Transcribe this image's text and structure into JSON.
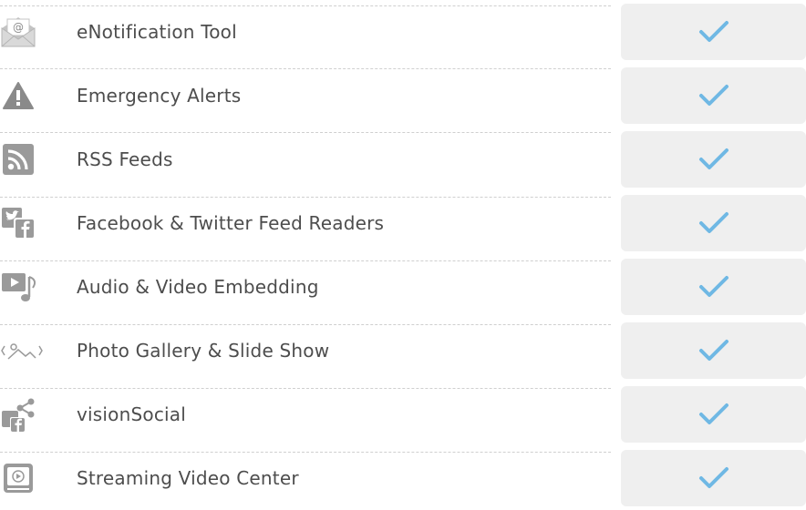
{
  "features": [
    {
      "label": "eNotification Tool",
      "icon": "envelope-at-icon",
      "included": true
    },
    {
      "label": "Emergency Alerts",
      "icon": "warning-triangle-icon",
      "included": true
    },
    {
      "label": "RSS Feeds",
      "icon": "rss-icon",
      "included": true
    },
    {
      "label": "Facebook & Twitter Feed Readers",
      "icon": "facebook-twitter-icon",
      "included": true
    },
    {
      "label": "Audio & Video Embedding",
      "icon": "audio-video-icon",
      "included": true
    },
    {
      "label": "Photo Gallery & Slide Show",
      "icon": "photo-gallery-icon",
      "included": true
    },
    {
      "label": "visionSocial",
      "icon": "vision-social-icon",
      "included": true
    },
    {
      "label": "Streaming Video Center",
      "icon": "streaming-video-icon",
      "included": true
    }
  ],
  "colors": {
    "check": "#6fb8e4",
    "icon": "#8a8a8a",
    "text": "#4d4d4d",
    "cell_background": "#efefef",
    "divider": "#cfcfcf"
  }
}
